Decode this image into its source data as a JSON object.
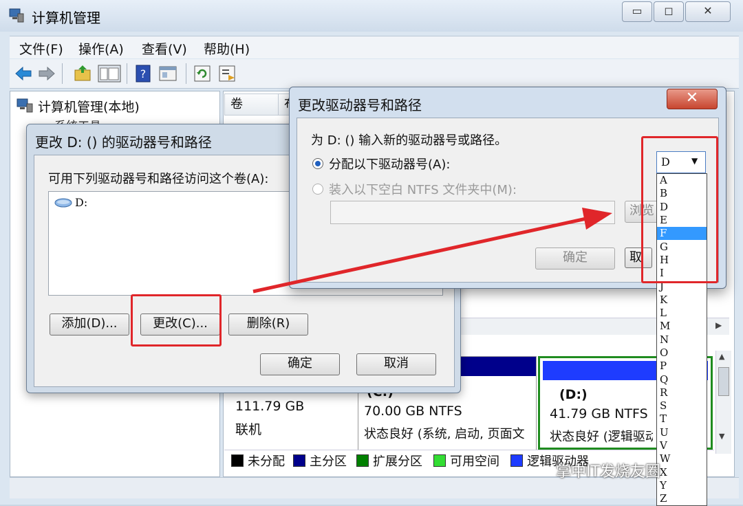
{
  "app": {
    "title": "计算机管理",
    "window_buttons": [
      "▭",
      "◻",
      "✕"
    ]
  },
  "menu": [
    "文件(F)",
    "操作(A)",
    "查看(V)",
    "帮助(H)"
  ],
  "tree": {
    "root": "计算机管理(本地)",
    "partial": "系统工具"
  },
  "list_header": {
    "col1": "卷",
    "col2": "布"
  },
  "disks": [
    {
      "size": "111.79 GB",
      "status": "联机"
    }
  ],
  "partitions": [
    {
      "label": "(C:)",
      "fs": "70.00 GB NTFS",
      "status": "状态良好 (系统, 启动, 页面文"
    },
    {
      "label": "(D:)",
      "fs": "41.79 GB NTFS",
      "status": "状态良好 (逻辑驱动"
    }
  ],
  "legend": [
    {
      "label": "未分配",
      "color": "#000000"
    },
    {
      "label": "主分区",
      "color": "#00008b"
    },
    {
      "label": "扩展分区",
      "color": "#008000"
    },
    {
      "label": "可用空间",
      "color": "#33dd33"
    },
    {
      "label": "逻辑驱动器",
      "color": "#1e3cff"
    }
  ],
  "dialog1": {
    "title": "更改 D: () 的驱动器号和路径",
    "label": "可用下列驱动器号和路径访问这个卷(A):",
    "items": [
      "D:"
    ],
    "add_button": "添加(D)...",
    "change_button": "更改(C)...",
    "delete_button": "删除(R)",
    "ok_button": "确定",
    "cancel_button": "取消"
  },
  "dialog2": {
    "title": "更改驱动器号和路径",
    "close": "✕",
    "prompt": "为 D: () 输入新的驱动器号或路径。",
    "assign_option": "分配以下驱动器号(A):",
    "mount_option": "装入以下空白 NTFS 文件夹中(M):",
    "browse_button": "浏览",
    "ok_button": "确定",
    "cancel_button": "取消",
    "selected_letter": "D",
    "letters": [
      "A",
      "B",
      "D",
      "E",
      "F",
      "G",
      "H",
      "I",
      "J",
      "K",
      "L",
      "M",
      "N",
      "O",
      "P",
      "Q",
      "R",
      "S",
      "T",
      "U",
      "V",
      "W",
      "X",
      "Y",
      "Z"
    ],
    "highlighted_letter": "F"
  },
  "watermark": "掌中IT发烧友圈",
  "colors": {
    "annotation_red": "#e0262a",
    "selection_blue": "#3399ff",
    "primary_partition": "#00008b",
    "logical_drive": "#1e3cff"
  }
}
